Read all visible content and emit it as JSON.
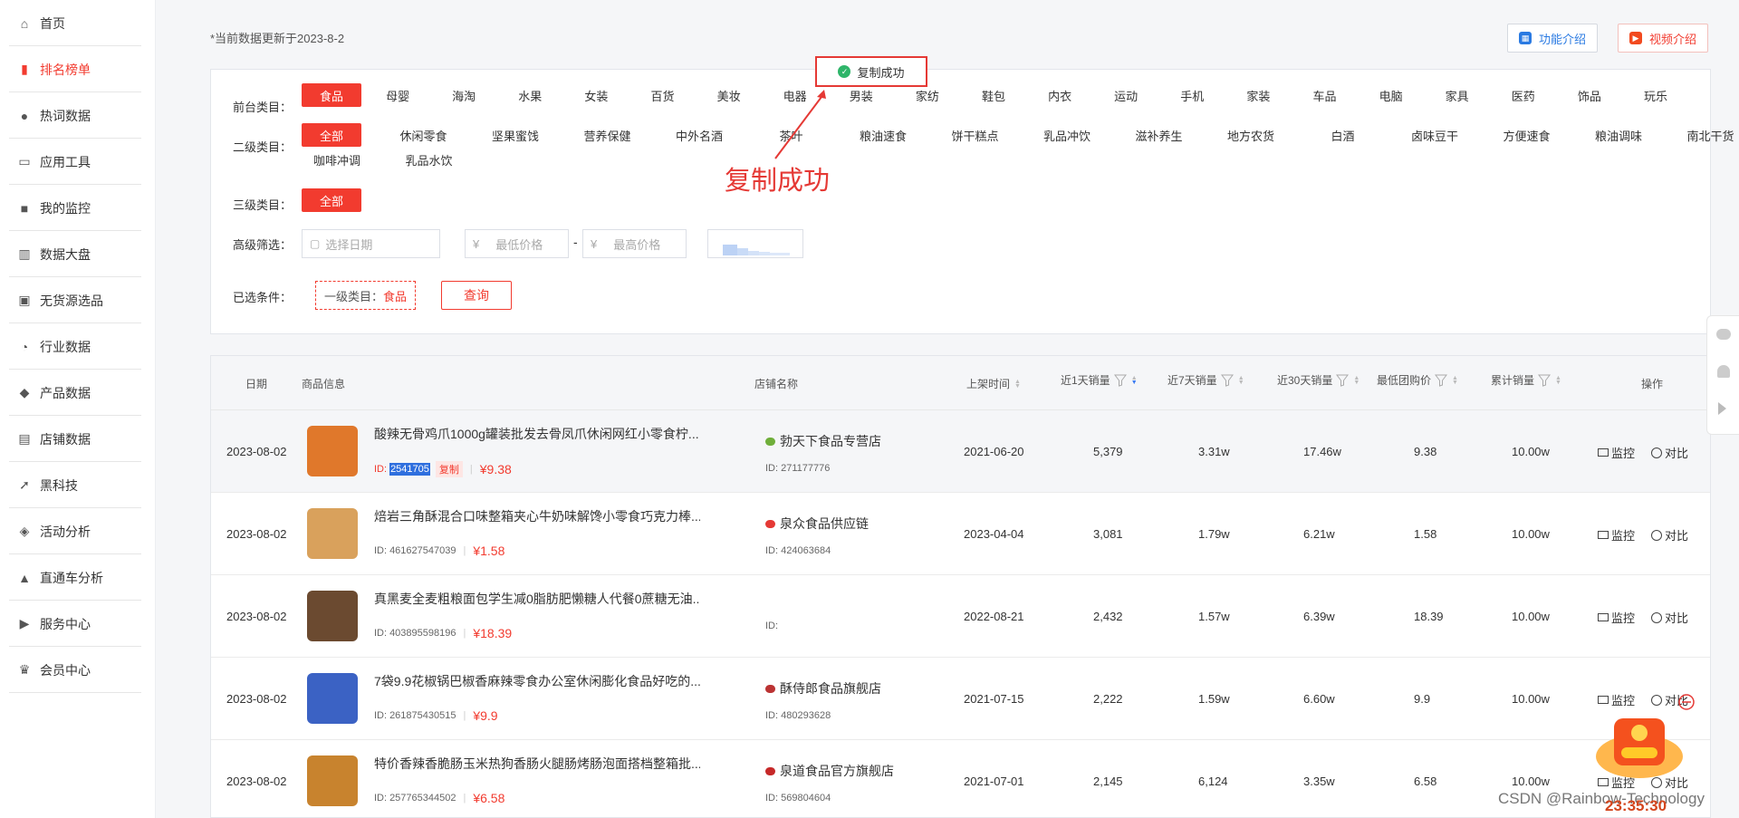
{
  "sidebar": {
    "items": [
      {
        "label": "首页",
        "icon": "home-icon"
      },
      {
        "label": "排名榜单",
        "icon": "bar-chart-icon",
        "active": true
      },
      {
        "label": "热词数据",
        "icon": "flame-icon"
      },
      {
        "label": "应用工具",
        "icon": "monitor-icon"
      },
      {
        "label": "我的监控",
        "icon": "camera-icon"
      },
      {
        "label": "数据大盘",
        "icon": "dashboard-icon"
      },
      {
        "label": "无货源选品",
        "icon": "box-icon"
      },
      {
        "label": "行业数据",
        "icon": "pie-icon"
      },
      {
        "label": "产品数据",
        "icon": "cube-icon"
      },
      {
        "label": "店铺数据",
        "icon": "store-icon"
      },
      {
        "label": "黑科技",
        "icon": "rocket-icon"
      },
      {
        "label": "活动分析",
        "icon": "tag-icon"
      },
      {
        "label": "直通车分析",
        "icon": "trend-icon"
      },
      {
        "label": "服务中心",
        "icon": "service-icon"
      },
      {
        "label": "会员中心",
        "icon": "crown-icon"
      }
    ]
  },
  "header": {
    "update_note": "*当前数据更新于2023-8-2",
    "feature_btn": "功能介绍",
    "video_btn": "视频介绍"
  },
  "filters": {
    "level1_label": "前台类目：",
    "level1": [
      "食品",
      "母婴",
      "海淘",
      "水果",
      "女装",
      "百货",
      "美妆",
      "电器",
      "男装",
      "家纺",
      "鞋包",
      "内衣",
      "运动",
      "手机",
      "家装",
      "车品",
      "电脑",
      "家具",
      "医药",
      "饰品",
      "玩乐"
    ],
    "level2_label": "二级类目：",
    "level2": [
      "全部",
      "休闲零食",
      "坚果蜜饯",
      "营养保健",
      "中外名酒",
      "茶叶",
      "粮油速食",
      "饼干糕点",
      "乳品冲饮",
      "滋补养生",
      "地方农货",
      "白酒",
      "卤味豆干",
      "方便速食",
      "粮油调味",
      "南北干货"
    ],
    "level2_row2": [
      "咖啡冲调",
      "乳品水饮"
    ],
    "level3_label": "三级类目：",
    "level3": [
      "全部"
    ],
    "advanced_label": "高级筛选：",
    "date_placeholder": "选择日期",
    "currency": "¥",
    "min_price_placeholder": "最低价格",
    "max_price_placeholder": "最高价格",
    "dash": "-",
    "selected_label": "已选条件：",
    "selected_tag_prefix": "一级类目：",
    "selected_tag_value": "食品",
    "query_btn": "查询"
  },
  "toast": {
    "text": "复制成功"
  },
  "annotation": {
    "text": "复制成功"
  },
  "table": {
    "headers": {
      "date": "日期",
      "product": "商品信息",
      "shop": "店铺名称",
      "listed": "上架时间",
      "sales1": "近1天销量",
      "sales7": "近7天销量",
      "sales30": "近30天销量",
      "min_price": "最低团购价",
      "total_sales": "累计销量",
      "op": "操作"
    },
    "id_prefix": "ID:",
    "copy_label": "复制",
    "monitor_label": "监控",
    "compare_label": "对比",
    "rows": [
      {
        "date": "2023-08-02",
        "title": "酸辣无骨鸡爪1000g罐装批发去骨凤爪休闲网红小零食柠...",
        "id": "2541705",
        "price": "¥9.38",
        "shop": "勃天下食品专营店",
        "shop_id": "271177776",
        "listed": "2021-06-20",
        "s1": "5,379",
        "s7": "3.31w",
        "s30": "17.46w",
        "minp": "9.38",
        "total": "10.00w"
      },
      {
        "date": "2023-08-02",
        "title": "焙岩三角酥混合口味整箱夹心牛奶味解馋小零食巧克力棒...",
        "id": "461627547039",
        "price": "¥1.58",
        "shop": "泉众食品供应链",
        "shop_id": "424063684",
        "listed": "2023-04-04",
        "s1": "3,081",
        "s7": "1.79w",
        "s30": "6.21w",
        "minp": "1.58",
        "total": "10.00w"
      },
      {
        "date": "2023-08-02",
        "title": "真黑麦全麦粗粮面包学生减0脂肪肥懒糖人代餐0蔗糖无油...",
        "id": "403895598196",
        "price": "¥18.39",
        "shop": "",
        "shop_id": "",
        "listed": "2022-08-21",
        "s1": "2,432",
        "s7": "1.57w",
        "s30": "6.39w",
        "minp": "18.39",
        "total": "10.00w"
      },
      {
        "date": "2023-08-02",
        "title": "7袋9.9花椒锅巴椒香麻辣零食办公室休闲膨化食品好吃的...",
        "id": "261875430515",
        "price": "¥9.9",
        "shop": "酥侍郎食品旗舰店",
        "shop_id": "480293628",
        "listed": "2021-07-15",
        "s1": "2,222",
        "s7": "1.59w",
        "s30": "6.60w",
        "minp": "9.9",
        "total": "10.00w"
      },
      {
        "date": "2023-08-02",
        "title": "特价香辣香脆肠玉米热狗香肠火腿肠烤肠泡面搭档整箱批...",
        "id": "257765344502",
        "price": "¥6.58",
        "shop": "泉道食品官方旗舰店",
        "shop_id": "569804604",
        "listed": "2021-07-01",
        "s1": "2,145",
        "s7": "6,124",
        "s30": "3.35w",
        "minp": "6.58",
        "total": "10.00w"
      }
    ]
  },
  "overlay": {
    "watermark": "CSDN @Rainbow-Technology",
    "timer": "23:35:30"
  },
  "colors": {
    "accent": "#f23b2f",
    "link": "#3a7bf2"
  }
}
